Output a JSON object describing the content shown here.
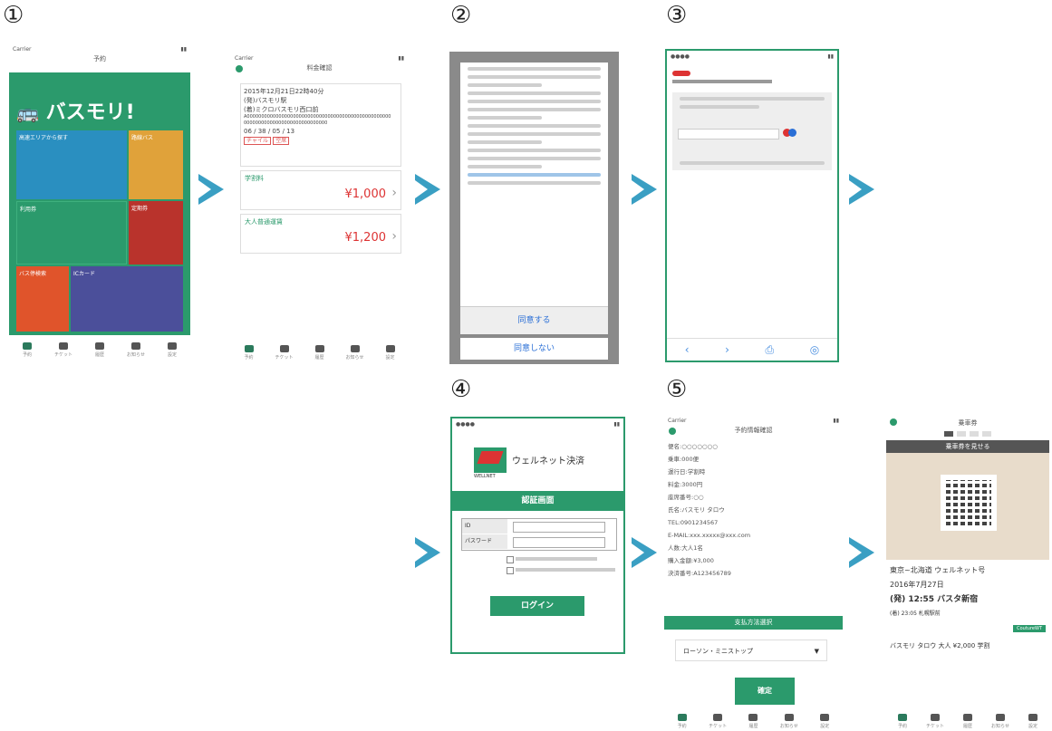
{
  "steps": {
    "s1": "①",
    "s2": "②",
    "s3": "③",
    "s4": "④",
    "s5": "⑤"
  },
  "screen1": {
    "carrier": "Carrier",
    "title": "予約",
    "logo": "バスモリ!",
    "tiles": [
      "高速エリアから探す",
      "路線バス",
      "利用券",
      "定期券",
      "バス停検索",
      "ICカード"
    ]
  },
  "screen2": {
    "carrier": "Carrier",
    "title": "料金確認",
    "date": "2015年12月21日22時40分",
    "route1": "(発)バスモリ駅",
    "route2": "(着)ミクロバスモリ西口前",
    "code1": "A00000000000000000000000000000000000000000000000000",
    "code2": "00000000000000000000000000000",
    "seat": "06 / 38 / 05 / 13",
    "tag1": "チャイル",
    "tag2": "空席",
    "fare1_label": "学割料",
    "fare1_price": "¥1,000",
    "fare2_label": "大人普通運賃",
    "fare2_price": "¥1,200"
  },
  "screen3": {
    "accept": "同意する",
    "decline": "同意しない"
  },
  "screen4": {
    "brand": "ウェルネット決済",
    "brand_sub": "WELLNET",
    "header": "認証画面",
    "field1": "ID",
    "field2": "パスワード",
    "login": "ログイン"
  },
  "screen5": {
    "carrier": "Carrier",
    "title": "予約情報確認",
    "rows": [
      "便名:○○○○○○○",
      "乗車:000便",
      "運行日:学割時",
      "料金:3000円",
      "座席番号:○○",
      "氏名:バスモリ タロウ",
      "TEL:0901234567",
      "E-MAIL:xxx.xxxxx@xxx.com",
      "人数:大人1名",
      "購入金額:¥3,000",
      "決済番号:A123456789"
    ],
    "pay_header": "支払方法選択",
    "store": "ローソン・ミニストップ",
    "confirm": "確定"
  },
  "screen6": {
    "title": "乗車券",
    "banner": "乗車券を見せる",
    "route": "東京~北海道 ウェルネット号",
    "date": "2016年7月27日",
    "dep": "(発) 12:55 バスタ新宿",
    "arr": "(着) 23:05 札幌駅前",
    "badge": "CoutureWT",
    "passenger": "バスモリ タロウ 大人 ¥2,000 学割"
  },
  "tabs": [
    "予約",
    "チケット",
    "履歴",
    "お知らせ",
    "設定"
  ],
  "colors": {
    "green": "#2b9a6c",
    "arrow": "#3a9fc3"
  }
}
